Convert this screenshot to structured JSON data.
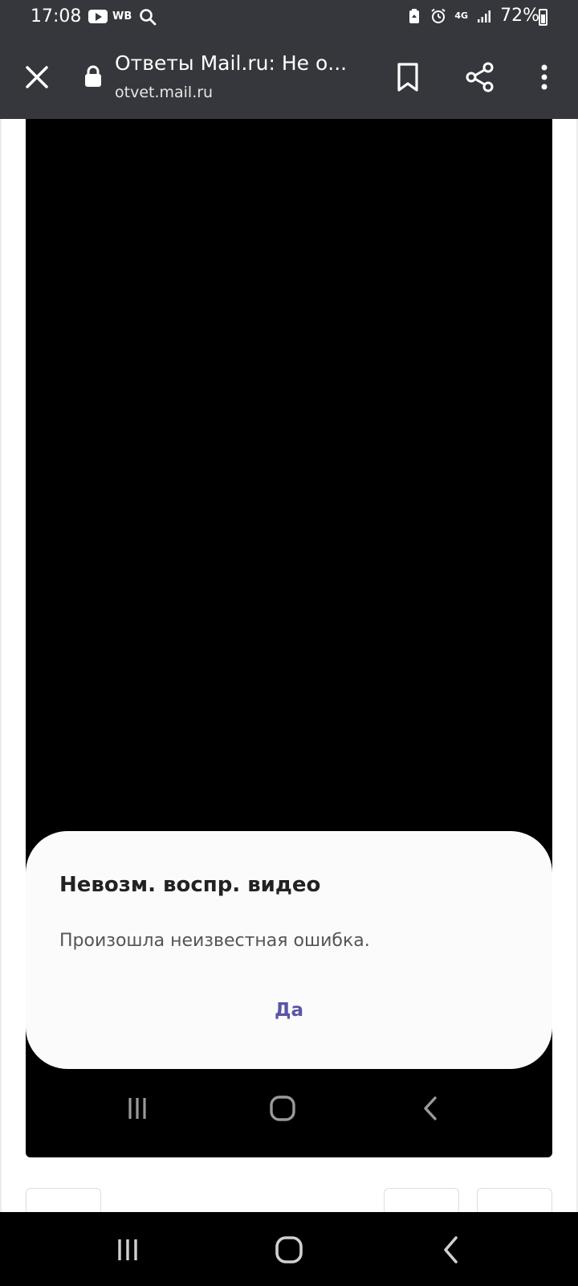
{
  "status_bar": {
    "time": "17:08",
    "carrier_badge": "WB",
    "network": "4G",
    "battery": "72%",
    "icons": [
      "youtube-icon",
      "search-icon",
      "battery-saver-icon",
      "alarm-icon",
      "network-4g-icon",
      "signal-icon",
      "battery-icon"
    ]
  },
  "toolbar": {
    "title": "Ответы Mail.ru: Не о...",
    "url": "otvet.mail.ru",
    "icons": [
      "close-icon",
      "lock-icon",
      "bookmark-icon",
      "share-icon",
      "more-vert-icon"
    ]
  },
  "dialog": {
    "title": "Невозм. воспр. видео",
    "message": "Произошла неизвестная ошибка.",
    "button": "Да"
  },
  "colors": {
    "toolbar_bg": "#36373c",
    "dialog_button": "#5a55a8",
    "embed_bg": "#000000"
  }
}
